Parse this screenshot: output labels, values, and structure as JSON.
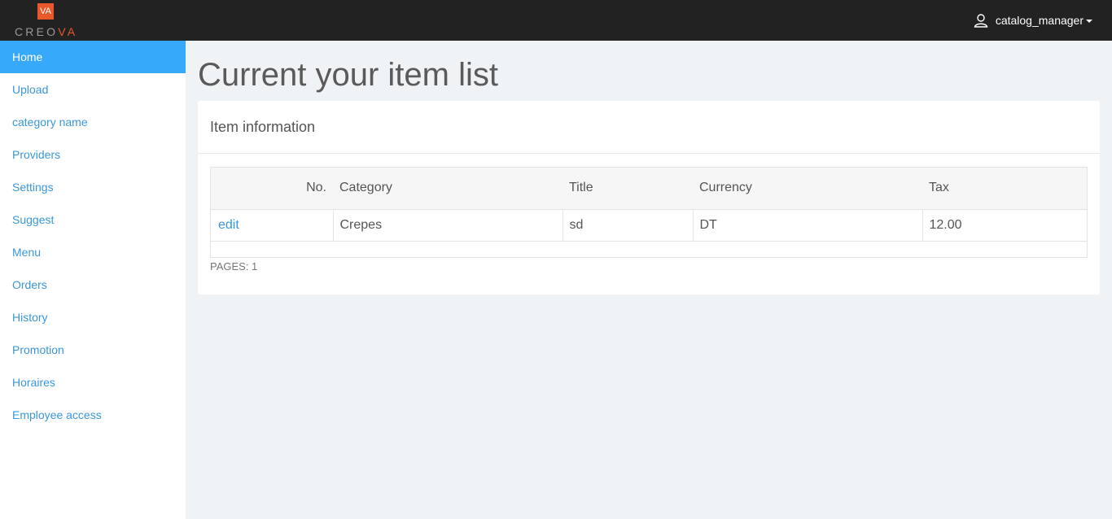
{
  "header": {
    "logo_mark": "VA",
    "logo_text_prefix": "CREO",
    "logo_text_accent": "VA",
    "user_name": "catalog_manager"
  },
  "sidebar": {
    "items": [
      {
        "label": "Home",
        "active": true
      },
      {
        "label": "Upload"
      },
      {
        "label": "category name"
      },
      {
        "label": "Providers"
      },
      {
        "label": "Settings"
      },
      {
        "label": "Suggest"
      },
      {
        "label": "Menu"
      },
      {
        "label": "Orders"
      },
      {
        "label": "History"
      },
      {
        "label": "Promotion"
      },
      {
        "label": "Horaires"
      },
      {
        "label": "Employee access"
      }
    ]
  },
  "main": {
    "title": "Current your item list",
    "panel_heading": "Item information",
    "table": {
      "columns": [
        "No.",
        "Category",
        "Title",
        "Currency",
        "Tax"
      ],
      "rows": [
        {
          "action": "edit",
          "category": "Crepes",
          "title": "sd",
          "currency": "DT",
          "tax": "12.00"
        }
      ]
    },
    "pages_text": "PAGES: 1"
  },
  "colors": {
    "topbar": "#222222",
    "accent": "#36a9fa",
    "link": "#3a97d8",
    "brand": "#e8582a"
  }
}
